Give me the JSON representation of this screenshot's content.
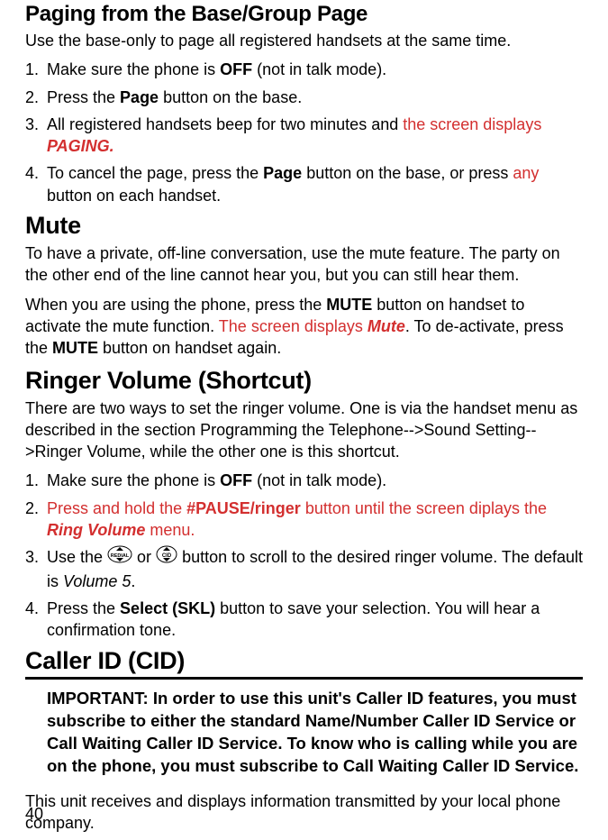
{
  "sections": {
    "paging": {
      "heading": "Paging from the Base/Group Page",
      "intro": "Use the base-only to page all registered handsets at the same time.",
      "steps": [
        {
          "pre": "Make sure the phone is ",
          "bold1": "OFF",
          "post": " (not in talk mode)."
        },
        {
          "pre": "Press the ",
          "bold1": "Page",
          "post": " button on the base."
        },
        {
          "pre": "All registered handsets beep for two minutes and ",
          "red1": "the screen displays ",
          "redbolditalic": "PAGING.",
          "post": ""
        },
        {
          "pre": "To cancel the page, press the ",
          "bold1": "Page",
          "mid": " button on the base, or press ",
          "red1": "any",
          "post": " button on each handset."
        }
      ]
    },
    "mute": {
      "heading": "Mute",
      "p1": "To have a private, off-line conversation, use the mute feature. The party on the other end of the line cannot hear you, but you can still hear them.",
      "p2": {
        "t1": "When you are using the phone, press the ",
        "b1": "MUTE",
        "t2": " button on handset to activate the mute function. ",
        "r1": "The screen displays ",
        "rbi": "Mute",
        "t3": ". To de-activate, press the ",
        "b2": "MUTE",
        "t4": " button on handset again."
      }
    },
    "ringer": {
      "heading": "Ringer Volume (Shortcut)",
      "intro": "There are two ways to set the ringer volume. One is via the handset menu as described in the section Programming the Telephone-->Sound Setting-->Ringer Volume, while the other one is this shortcut.",
      "steps": {
        "s1": {
          "pre": "Make sure the phone is ",
          "bold1": "OFF",
          "post": " (not in talk mode)."
        },
        "s2": {
          "r1": "Press and hold the ",
          "rb": "#PAUSE/ringer",
          "r2": " button until the screen diplays the ",
          "rbi": "Ring Volume",
          "r3": " menu."
        },
        "s3": {
          "pre": "Use the ",
          "mid": " or ",
          "post": " button to scroll to the desired ringer volume. The default is ",
          "italic": "Volume 5",
          "end": "."
        },
        "s4": {
          "pre": "Press the ",
          "bold1": "Select (SKL)",
          "post": " button to save your selection. You will hear a confirmation tone."
        }
      }
    },
    "cid": {
      "heading": "Caller ID (CID)",
      "important": "IMPORTANT: In order to use this unit's Caller ID features, you must subscribe to either the standard Name/Number Caller ID Service or Call Waiting Caller ID Service. To know who is calling while you are on the phone, you must subscribe to Call Waiting Caller ID Service.",
      "p1": "This unit receives and displays information transmitted by your local phone company."
    }
  },
  "page_number": "40"
}
